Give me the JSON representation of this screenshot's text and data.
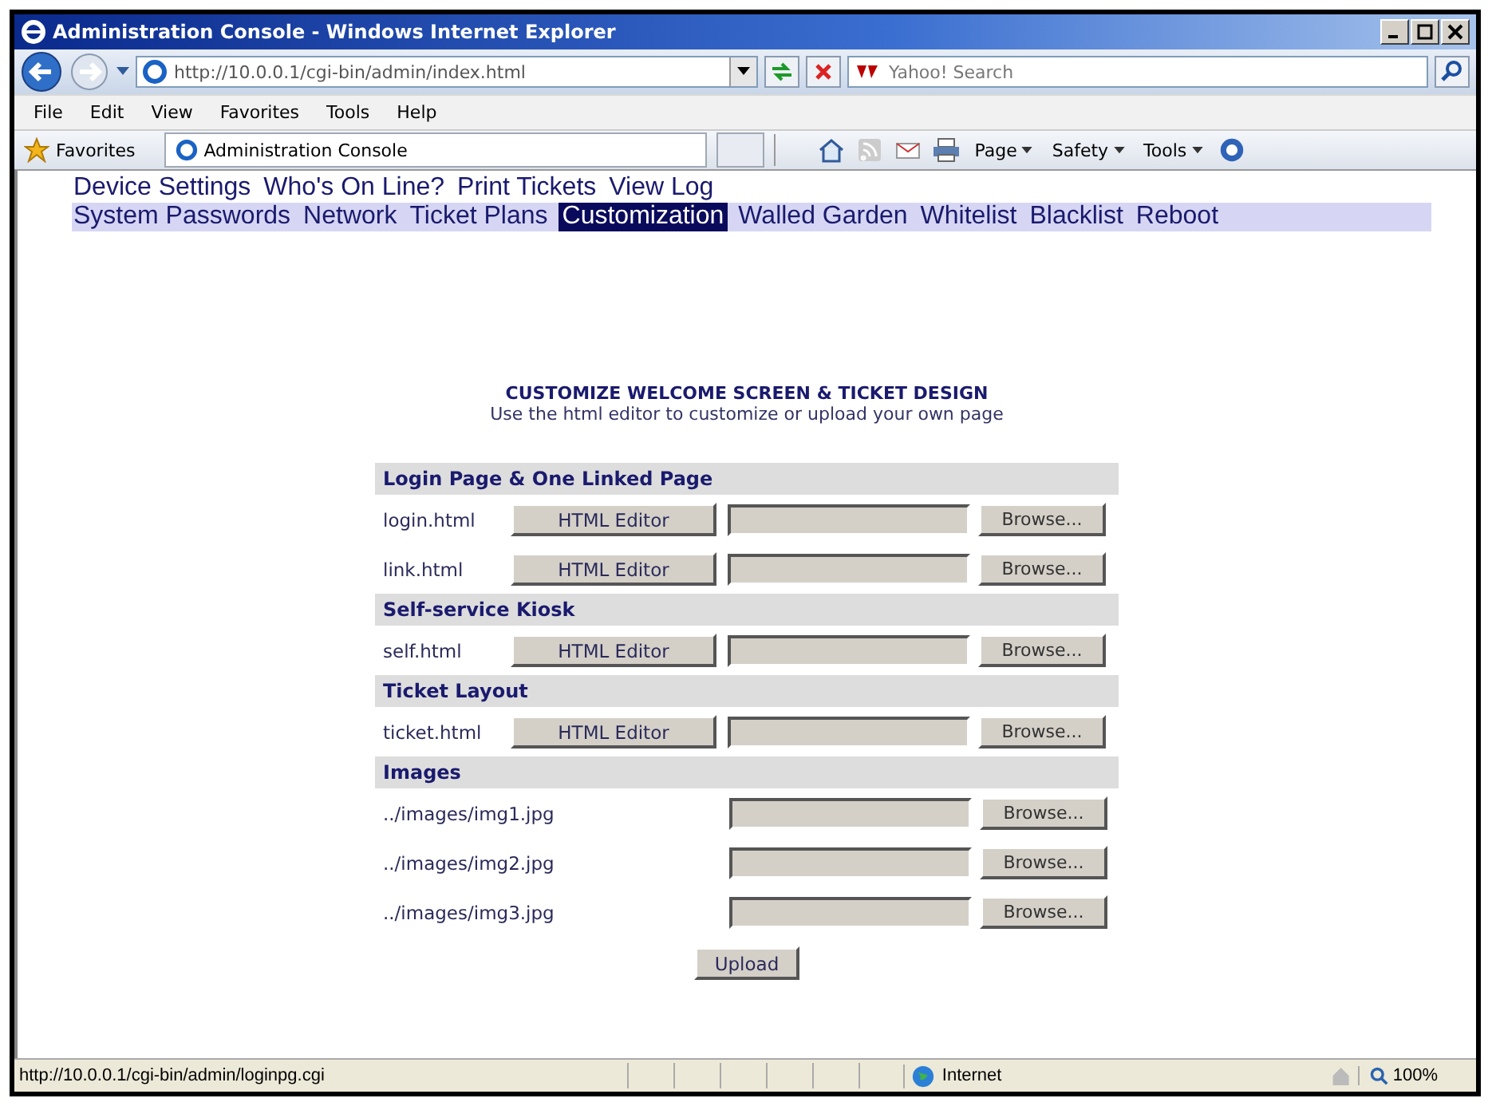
{
  "window": {
    "title": "Administration Console - Windows Internet Explorer"
  },
  "address_bar": {
    "url": "http://10.0.0.1/cgi-bin/admin/index.html"
  },
  "search": {
    "placeholder": "Yahoo! Search"
  },
  "menu": [
    "File",
    "Edit",
    "View",
    "Favorites",
    "Tools",
    "Help"
  ],
  "favorites_label": "Favorites",
  "browser_tab": {
    "title": "Administration Console"
  },
  "command_bar": [
    "Page",
    "Safety",
    "Tools"
  ],
  "nav_rows": [
    [
      {
        "label": "Device Settings",
        "selected": false
      },
      {
        "label": "Who's On Line?",
        "selected": false
      },
      {
        "label": "Print Tickets",
        "selected": false
      },
      {
        "label": "View Log",
        "selected": false
      }
    ],
    [
      {
        "label": "System Passwords",
        "selected": false
      },
      {
        "label": "Network",
        "selected": false
      },
      {
        "label": "Ticket Plans",
        "selected": false
      },
      {
        "label": "Customization",
        "selected": true
      },
      {
        "label": "Walled Garden",
        "selected": false
      },
      {
        "label": "Whitelist",
        "selected": false
      },
      {
        "label": "Blacklist",
        "selected": false
      },
      {
        "label": "Reboot",
        "selected": false
      }
    ]
  ],
  "heading": "CUSTOMIZE WELCOME SCREEN & TICKET DESIGN",
  "subheading": "Use the html editor to customize or upload your own page",
  "sections": [
    {
      "title": "Login Page & One Linked Page",
      "rows": [
        {
          "kind": "editor",
          "file": "login.html",
          "editor": "HTML Editor",
          "browse": "Browse..."
        },
        {
          "kind": "editor",
          "file": "link.html",
          "editor": "HTML Editor",
          "browse": "Browse..."
        }
      ]
    },
    {
      "title": "Self-service Kiosk",
      "rows": [
        {
          "kind": "editor",
          "file": "self.html",
          "editor": "HTML Editor",
          "browse": "Browse..."
        }
      ]
    },
    {
      "title": "Ticket Layout",
      "rows": [
        {
          "kind": "editor",
          "file": "ticket.html",
          "editor": "HTML Editor",
          "browse": "Browse..."
        }
      ]
    },
    {
      "title": "Images",
      "rows": [
        {
          "kind": "image",
          "file": "../images/img1.jpg",
          "browse": "Browse..."
        },
        {
          "kind": "image",
          "file": "../images/img2.jpg",
          "browse": "Browse..."
        },
        {
          "kind": "image",
          "file": "../images/img3.jpg",
          "browse": "Browse..."
        }
      ]
    }
  ],
  "upload_button": "Upload",
  "status_bar": {
    "url": "http://10.0.0.1/cgi-bin/admin/loginpg.cgi",
    "zone": "Internet",
    "zoom": "100%"
  }
}
